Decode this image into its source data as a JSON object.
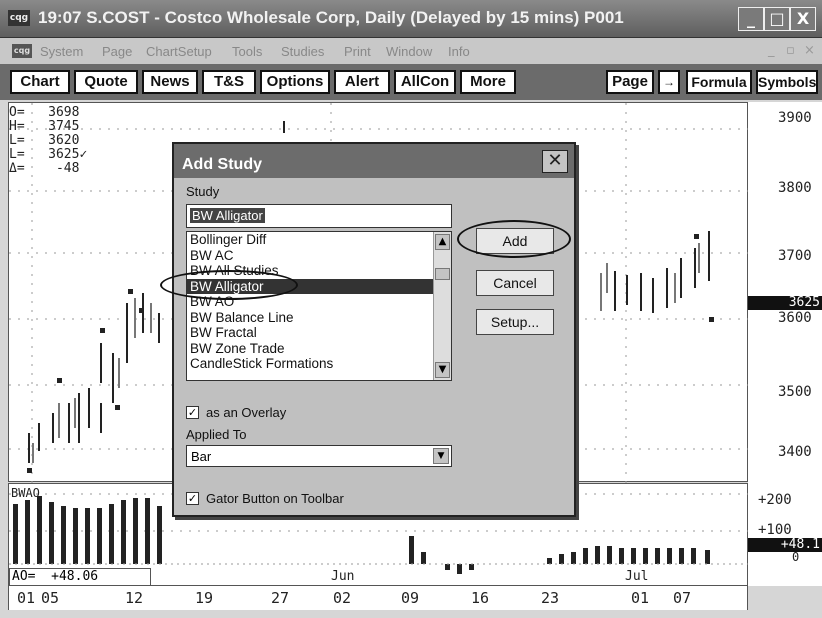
{
  "window": {
    "title": "19:07  S.COST - Costco Wholesale Corp, Daily (Delayed by 15 mins)  P001",
    "app_icon_text": "cqg",
    "controls": {
      "minimize": "_",
      "maximize": "□",
      "close": "X"
    }
  },
  "menu": {
    "items": [
      "System",
      "Page",
      "ChartSetup",
      "Tools",
      "Studies",
      "Print",
      "Window",
      "Info"
    ],
    "mdi_controls": [
      "_",
      "▫",
      "×"
    ]
  },
  "toolbar": {
    "left_buttons": [
      "Chart",
      "Quote",
      "News",
      "T&S",
      "Options",
      "Alert",
      "AllCon",
      "More"
    ],
    "right_buttons": [
      "Page",
      "Formula",
      "Symbols"
    ],
    "link_glyph": "→"
  },
  "ohlc_readout": {
    "O": "3698",
    "H": "3745",
    "L1": "3620",
    "L2": "3625✓",
    "delta": "-48"
  },
  "price_axis": {
    "labels": [
      "3900",
      "3800",
      "3700",
      "3600",
      "3500",
      "3400"
    ],
    "current": "3625"
  },
  "indicator": {
    "name": "BWAO",
    "readout_label": "AO=",
    "readout_value": "+48.06",
    "axis_labels": [
      "+200",
      "+100",
      "0"
    ],
    "current": "+48.1"
  },
  "date_axis": {
    "days": [
      "01",
      "05",
      "12",
      "19",
      "27",
      "02",
      "09",
      "16",
      "23",
      "01",
      "07"
    ],
    "months": [
      "Jun",
      "Jul"
    ]
  },
  "dialog": {
    "title": "Add Study",
    "study_label": "Study",
    "study_value": "BW Alligator",
    "list_items": [
      "Bollinger Diff",
      "BW AC",
      "BW All Studies",
      "BW Alligator",
      "BW AO",
      "BW Balance Line",
      "BW Fractal",
      "BW Zone Trade",
      "CandleStick Formations"
    ],
    "selected_item": "BW Alligator",
    "buttons": {
      "add": "Add",
      "cancel": "Cancel",
      "setup": "Setup..."
    },
    "overlay_label": "as an Overlay",
    "overlay_checked": true,
    "applied_to_label": "Applied To",
    "applied_to_value": "Bar",
    "gator_label": "Gator Button on Toolbar",
    "gator_checked": true,
    "close_glyph": "✕"
  },
  "colors": {
    "title_bar": "#6c6c6c",
    "toolbar": "#6b6b6b",
    "selection": "#333333"
  }
}
